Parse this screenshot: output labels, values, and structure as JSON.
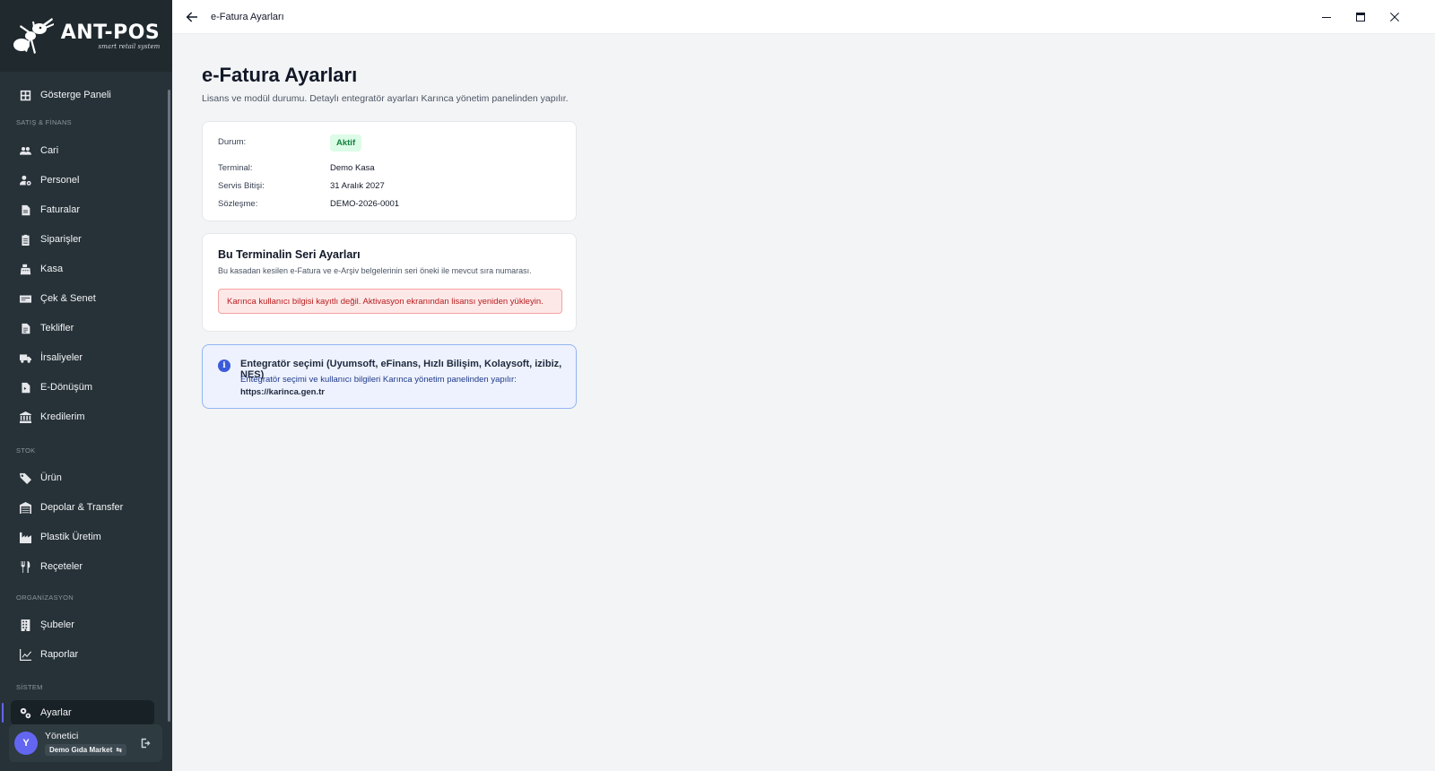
{
  "app": {
    "logo_title": "ANT-POS",
    "logo_subtitle": "smart retail system",
    "window_title": "e-Fatura Ayarları"
  },
  "sidebar": {
    "items": [
      {
        "label": "Gösterge Paneli",
        "icon": "dashboard-icon"
      },
      {
        "label": "Cari",
        "icon": "users-icon"
      },
      {
        "label": "Personel",
        "icon": "person-gear-icon"
      },
      {
        "label": "Faturalar",
        "icon": "document-icon"
      },
      {
        "label": "Siparişler",
        "icon": "clipboard-icon"
      },
      {
        "label": "Kasa",
        "icon": "cash-register-icon"
      },
      {
        "label": "Çek & Senet",
        "icon": "card-icon"
      },
      {
        "label": "Teklifler",
        "icon": "file-text-icon"
      },
      {
        "label": "İrsaliyeler",
        "icon": "truck-icon"
      },
      {
        "label": "E-Dönüşüm",
        "icon": "file-sync-icon"
      },
      {
        "label": "Kredilerim",
        "icon": "bank-icon"
      },
      {
        "label": "Ürün",
        "icon": "tag-icon"
      },
      {
        "label": "Depolar & Transfer",
        "icon": "warehouse-icon"
      },
      {
        "label": "Plastik Üretim",
        "icon": "factory-icon"
      },
      {
        "label": "Reçeteler",
        "icon": "utensils-icon"
      },
      {
        "label": "Şubeler",
        "icon": "building-icon"
      },
      {
        "label": "Raporlar",
        "icon": "chart-line-icon"
      },
      {
        "label": "Ayarlar",
        "icon": "gears-icon"
      }
    ],
    "sections": {
      "sales": "SATIŞ & FİNANS",
      "stock": "STOK",
      "org": "ORGANİZASYON",
      "system": "SİSTEM"
    },
    "user": {
      "initial": "Y",
      "name": "Yönetici",
      "shop": "Demo Gıda Market",
      "shop_icon": "swap-icon"
    }
  },
  "page": {
    "title": "e-Fatura Ayarları",
    "description": "Lisans ve modül durumu. Detaylı entegratör ayarları Karınca yönetim panelinden yapılır."
  },
  "license": {
    "status_label": "Durum:",
    "status_value": "Aktif",
    "terminal_label": "Terminal:",
    "terminal_value": "Demo Kasa",
    "service_end_label": "Servis Bitişi:",
    "service_end_value": "31 Aralık 2027",
    "contract_label": "Sözleşme:",
    "contract_value": "DEMO-2026-0001"
  },
  "series": {
    "title": "Bu Terminalin Seri Ayarları",
    "description": "Bu kasadan kesilen e-Fatura ve e-Arşiv belgelerinin seri öneki ile mevcut sıra numarası.",
    "alert": "Karınca kullanıcı bilgisi kayıtlı değil. Aktivasyon ekranından lisansı yeniden yükleyin."
  },
  "integrator": {
    "title": "Entegratör seçimi (Uyumsoft, eFinans, Hızlı Bilişim, Kolaysoft, izibiz, NES)",
    "text": "Entegratör seçimi ve kullanıcı bilgileri Karınca yönetim panelinden yapılır:",
    "link": "https://karinca.gen.tr"
  },
  "colors": {
    "sidebar_bg": "#263238",
    "accent": "#6366f1",
    "success": "#15803d",
    "danger": "#b91c1c",
    "info": "#3b5bdb"
  }
}
